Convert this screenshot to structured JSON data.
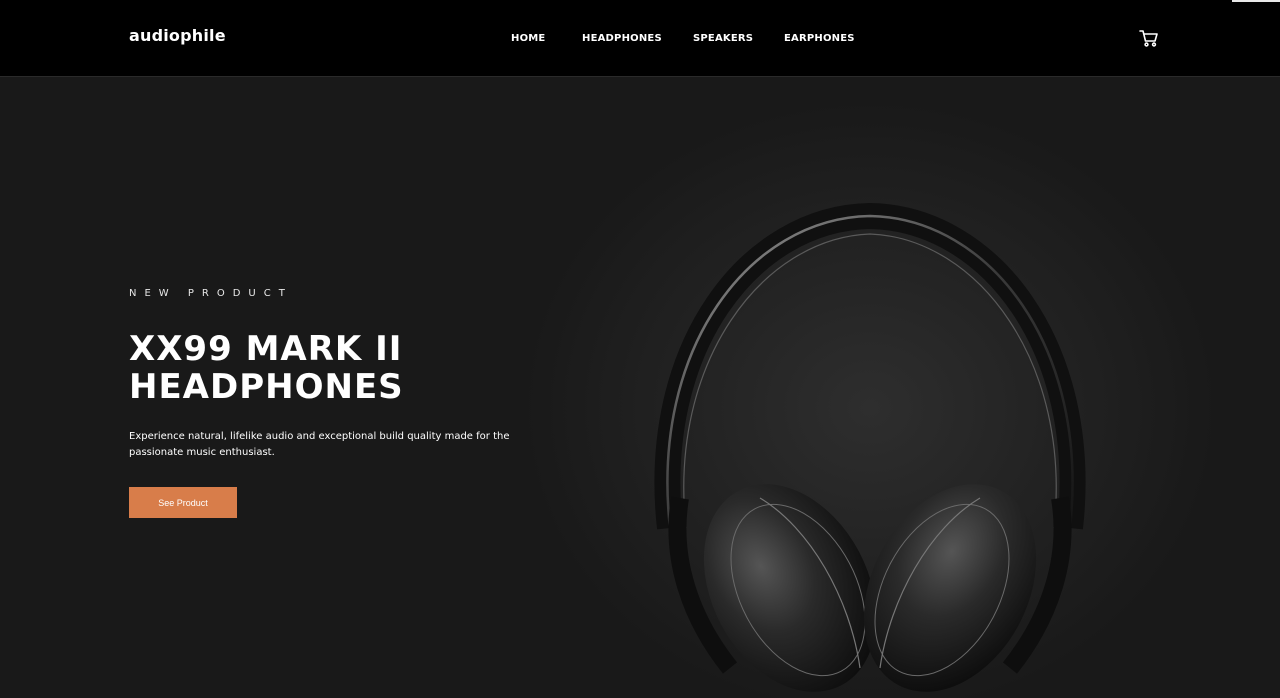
{
  "header": {
    "logo": "audiophile",
    "nav": [
      {
        "label": "HOME"
      },
      {
        "label": "HEADPHONES"
      },
      {
        "label": "SPEAKERS"
      },
      {
        "label": "EARPHONES"
      }
    ],
    "cart_icon": "cart-icon"
  },
  "hero": {
    "overline": "NEW PRODUCT",
    "title_line1": "XX99 MARK II",
    "title_line2": "HEADPHONES",
    "description": "Experience natural, lifelike audio and exceptional build quality made for the passionate music enthusiast.",
    "cta_label": "See Product",
    "image": "headphones-image"
  },
  "colors": {
    "header_bg": "#000000",
    "hero_bg": "#191919",
    "accent": "#d87d4a",
    "text": "#ffffff"
  }
}
